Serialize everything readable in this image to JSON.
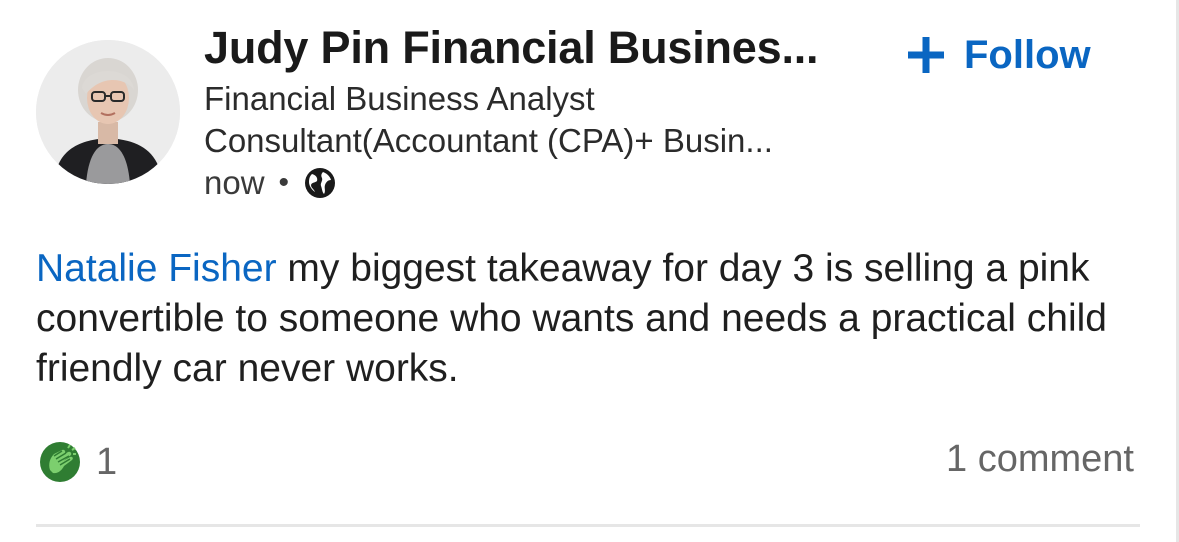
{
  "post": {
    "author": {
      "name": "Judy Pin Financial Busines...",
      "headline_line1": "Financial Business Analyst",
      "headline_line2": "Consultant(Accountant (CPA)+ Busin...",
      "time": "now",
      "separator": "•",
      "visibility_icon": "globe-icon"
    },
    "follow": {
      "icon": "plus-icon",
      "label": "Follow",
      "color": "#0a66c2"
    },
    "comment": {
      "mention": "Natalie Fisher",
      "text": " my biggest takeaway for day 3  is selling a pink convertible to someone who wants and needs  a practical child friendly car never works."
    },
    "social": {
      "reaction_icon": "celebrate-clap-icon",
      "reaction_count": "1",
      "comments_label": "1 comment"
    }
  }
}
